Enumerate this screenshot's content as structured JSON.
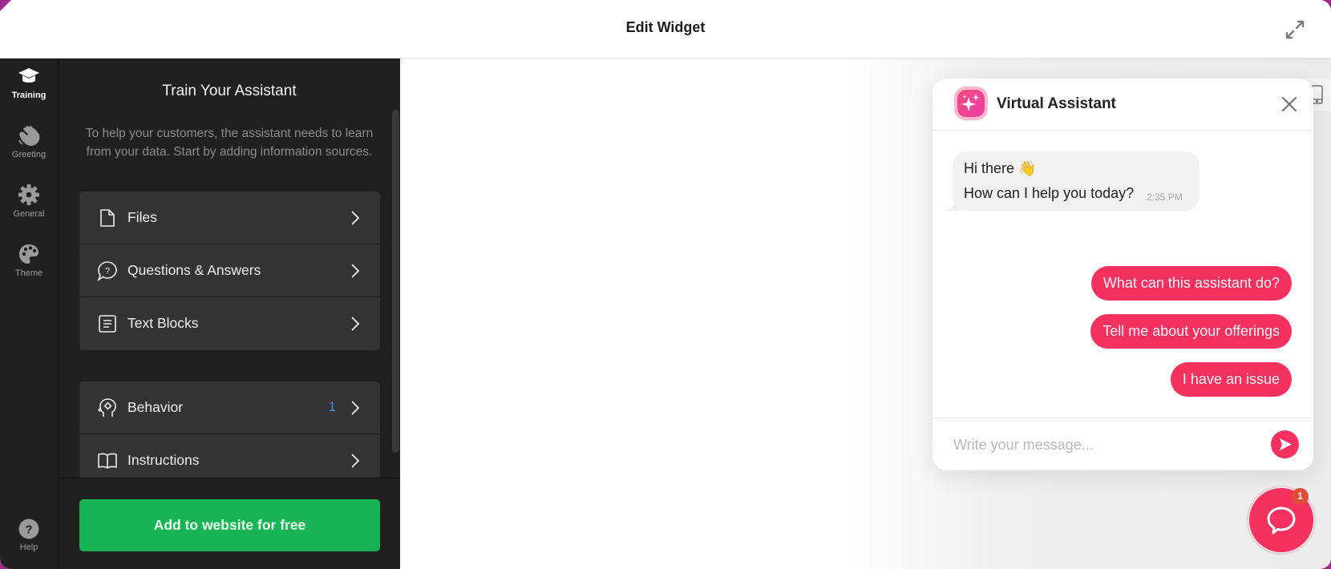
{
  "header": {
    "title": "Edit Widget",
    "expand_icon": "expand-arrows-icon"
  },
  "sidebar": {
    "items": [
      {
        "label": "Training",
        "icon": "graduation-cap-icon",
        "active": true
      },
      {
        "label": "Greeting",
        "icon": "waving-hand-icon",
        "active": false
      },
      {
        "label": "General",
        "icon": "gear-icon",
        "active": false
      },
      {
        "label": "Theme",
        "icon": "palette-icon",
        "active": false
      }
    ],
    "help": {
      "label": "Help",
      "icon": "help-circle-icon"
    }
  },
  "panel": {
    "title": "Train Your Assistant",
    "description": "To help your customers, the assistant needs to learn from your data. Start by adding information sources.",
    "sources": [
      {
        "label": "Files",
        "icon": "file-icon"
      },
      {
        "label": "Questions & Answers",
        "icon": "question-bubble-icon"
      },
      {
        "label": "Text Blocks",
        "icon": "text-block-icon"
      }
    ],
    "settings": [
      {
        "label": "Behavior",
        "icon": "head-gear-icon",
        "count": "1"
      },
      {
        "label": "Instructions",
        "icon": "open-book-icon",
        "count": ""
      }
    ],
    "cta_label": "Add to website for free"
  },
  "widget": {
    "title": "Virtual Assistant",
    "avatar_icon": "sparkles-icon",
    "greeting_line1": "Hi there 👋",
    "greeting_line2": "How can I help you today?",
    "timestamp": "2:35 PM",
    "suggestions": [
      "What can this assistant do?",
      "Tell me about your offerings",
      "I have an issue"
    ],
    "input_placeholder": "Write your message...",
    "input_value": "",
    "launcher_badge": "1",
    "accent_color": "#f5325f",
    "cta_color": "#16b455"
  }
}
